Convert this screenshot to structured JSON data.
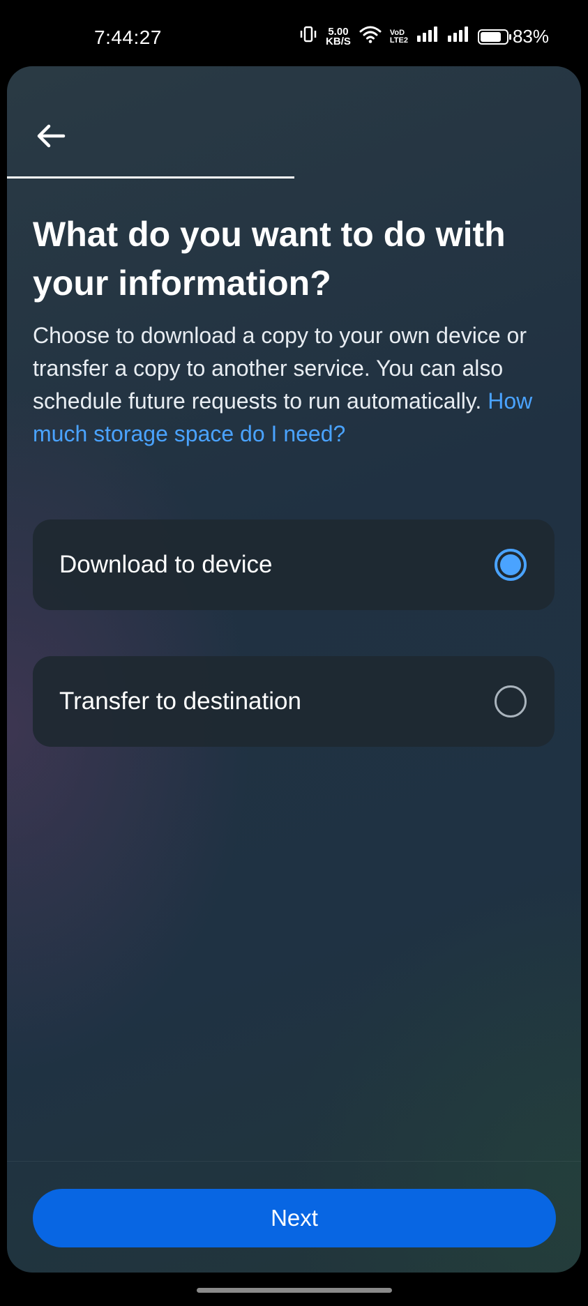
{
  "status_bar": {
    "time": "7:44:27",
    "net_speed_value": "5.00",
    "net_speed_unit": "KB/S",
    "volte_top": "VoD",
    "volte_bottom": "LTE2",
    "battery_percent": "83%",
    "battery_level": 0.83,
    "icons": [
      "vibrate-icon",
      "wifi-icon",
      "signal-icon",
      "signal-icon",
      "battery-icon"
    ]
  },
  "header": {
    "back_icon": "arrow-left-icon",
    "progress": 0.5
  },
  "main": {
    "title": "What do you want to do with your information?",
    "description": "Choose to download a copy to your own device or transfer a copy to another service. You can also schedule future requests to run automatically. ",
    "help_link": "How much storage space do I need?",
    "options": [
      {
        "label": "Download to device",
        "selected": true
      },
      {
        "label": "Transfer to destination",
        "selected": false
      }
    ]
  },
  "footer": {
    "next_label": "Next"
  },
  "colors": {
    "accent": "#0866e3",
    "link": "#4aa3ff",
    "card": "#1e2831"
  }
}
